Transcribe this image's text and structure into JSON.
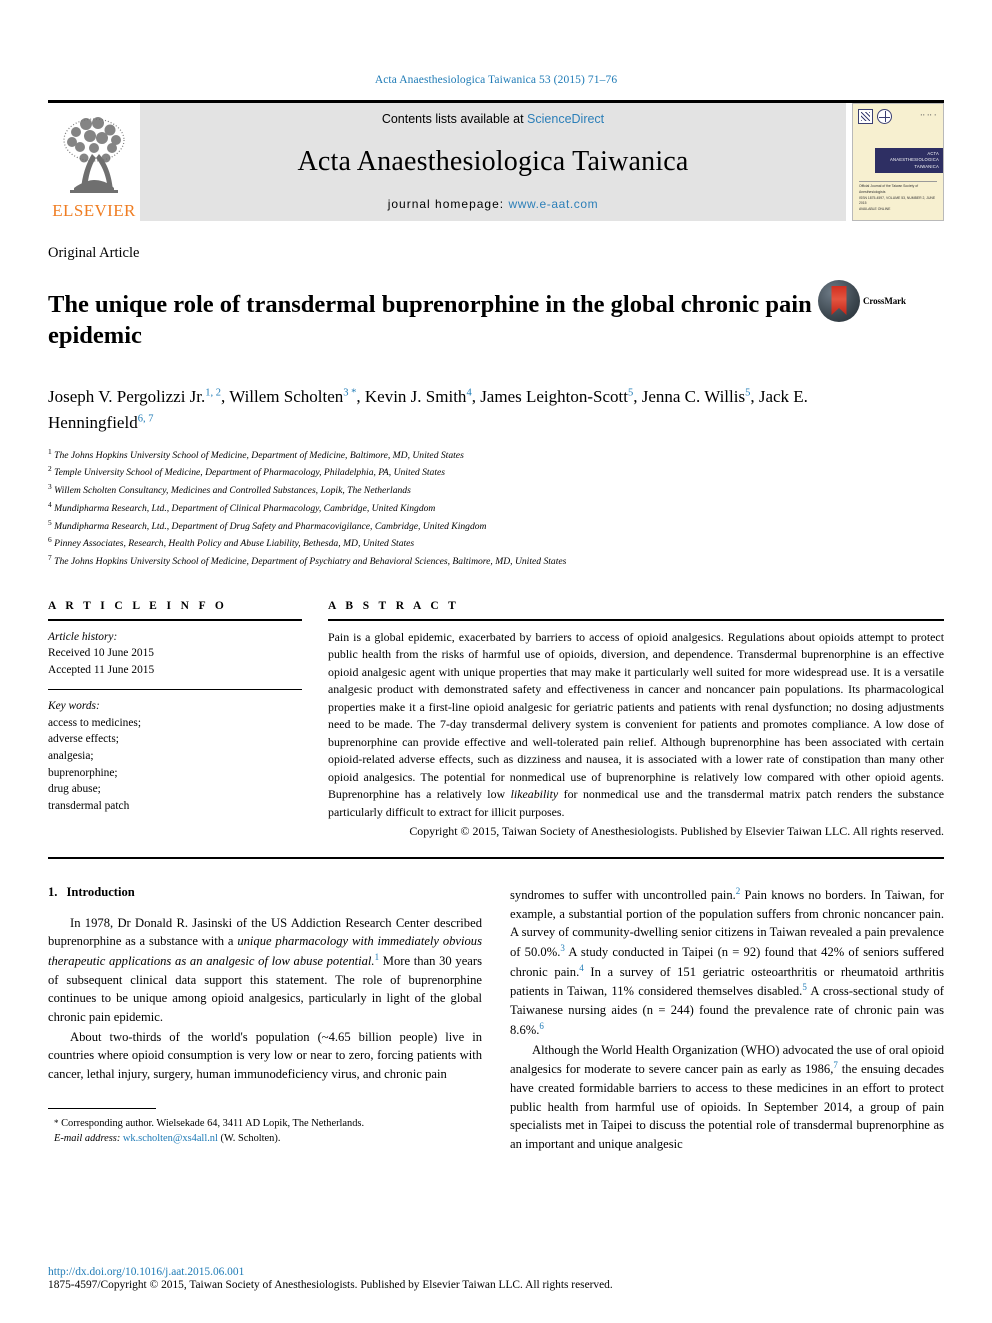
{
  "running_head": "Acta Anaesthesiologica Taiwanica 53 (2015) 71–76",
  "masthead": {
    "publisher_name": "ELSEVIER",
    "contents_prefix": "Contents lists available at ",
    "contents_link": "ScienceDirect",
    "journal_title": "Acta Anaesthesiologica Taiwanica",
    "homepage_label": "journal homepage: ",
    "homepage_url": "www.e-aat.com",
    "cover": {
      "band_line1": "ACTA ANAESTHESIOLOGICA",
      "band_line2": "TAIWANICA",
      "foot_line1": "Official Journal of the Taiwan Society of Anesthesiologists",
      "foot_line2": "ISSN 1875-4597, VOLUME 53, NUMBER 2, JUNE 2015",
      "foot_line3": "AVAILABLE ONLINE"
    }
  },
  "article": {
    "type": "Original Article",
    "title": "The unique role of transdermal buprenorphine in the global chronic pain epidemic",
    "crossmark_label": "CrossMark",
    "authors_line1": "Joseph V. Pergolizzi Jr.",
    "authors": [
      {
        "name": "Joseph V. Pergolizzi Jr.",
        "sup": "1, 2"
      },
      {
        "name": "Willem Scholten",
        "sup": "3 *"
      },
      {
        "name": "Kevin J. Smith",
        "sup": "4"
      },
      {
        "name": "James Leighton-Scott",
        "sup": "5"
      },
      {
        "name": "Jenna C. Willis",
        "sup": "5"
      },
      {
        "name": "Jack E. Henningfield",
        "sup": "6, 7"
      }
    ],
    "affiliations": [
      {
        "num": "1",
        "text": "The Johns Hopkins University School of Medicine, Department of Medicine, Baltimore, MD, United States"
      },
      {
        "num": "2",
        "text": "Temple University School of Medicine, Department of Pharmacology, Philadelphia, PA, United States"
      },
      {
        "num": "3",
        "text": "Willem Scholten Consultancy, Medicines and Controlled Substances, Lopik, The Netherlands"
      },
      {
        "num": "4",
        "text": "Mundipharma Research, Ltd., Department of Clinical Pharmacology, Cambridge, United Kingdom"
      },
      {
        "num": "5",
        "text": "Mundipharma Research, Ltd., Department of Drug Safety and Pharmacovigilance, Cambridge, United Kingdom"
      },
      {
        "num": "6",
        "text": "Pinney Associates, Research, Health Policy and Abuse Liability, Bethesda, MD, United States"
      },
      {
        "num": "7",
        "text": "The Johns Hopkins University School of Medicine, Department of Psychiatry and Behavioral Sciences, Baltimore, MD, United States"
      }
    ]
  },
  "article_info": {
    "heading": "A R T I C L E   I N F O",
    "history_label": "Article history:",
    "received": "Received 10 June 2015",
    "accepted": "Accepted 11 June 2015",
    "keywords_label": "Key words:",
    "keywords": [
      "access to medicines;",
      "adverse effects;",
      "analgesia;",
      "buprenorphine;",
      "drug abuse;",
      "transdermal patch"
    ]
  },
  "abstract": {
    "heading": "A B S T R A C T",
    "part1": "Pain is a global epidemic, exacerbated by barriers to access of opioid analgesics. Regulations about opioids attempt to protect public health from the risks of harmful use of opioids, diversion, and dependence. Transdermal buprenorphine is an effective opioid analgesic agent with unique properties that may make it particularly well suited for more widespread use. It is a versatile analgesic product with demonstrated safety and effectiveness in cancer and noncancer pain populations. Its pharmacological properties make it a first-line opioid analgesic for geriatric patients and patients with renal dysfunction; no dosing adjustments need to be made. The 7-day transdermal delivery system is convenient for patients and promotes compliance. A low dose of buprenorphine can provide effective and well-tolerated pain relief. Although buprenorphine has been associated with certain opioid-related adverse effects, such as dizziness and nausea, it is associated with a lower rate of constipation than many other opioid analgesics. The potential for nonmedical use of buprenorphine is relatively low compared with other opioid agents. Buprenorphine has a relatively low ",
    "italic_word": "likeability",
    "part2": " for nonmedical use and the transdermal matrix patch renders the substance particularly difficult to extract for illicit purposes.",
    "copyright": "Copyright © 2015, Taiwan Society of Anesthesiologists. Published by Elsevier Taiwan LLC. All rights reserved."
  },
  "introduction": {
    "section_number": "1.",
    "section_title": "Introduction",
    "p1_a": "In 1978, Dr Donald R. Jasinski of the US Addiction Research Center described buprenorphine as a substance with a ",
    "p1_italic": "unique pharmacology with immediately obvious therapeutic applications as an analgesic of low abuse potential.",
    "p1_cit": "1",
    "p1_b": " More than 30 years of subsequent clinical data support this statement. The role of buprenorphine continues to be unique among opioid analgesics, particularly in light of the global chronic pain epidemic.",
    "p2": "About two-thirds of the world's population (~4.65 billion people) live in countries where opioid consumption is very low or near to zero, forcing patients with cancer, lethal injury, surgery, human immunodeficiency virus, and chronic pain",
    "p2_cont_a": "syndromes to suffer with uncontrolled pain.",
    "p2_cit2": "2",
    "p2_cont_b": " Pain knows no borders. In Taiwan, for example, a substantial portion of the population suffers from chronic noncancer pain. A survey of community-dwelling senior citizens in Taiwan revealed a pain prevalence of 50.0%.",
    "p2_cit3": "3",
    "p2_cont_c": " A study conducted in Taipei (n = 92) found that 42% of seniors suffered chronic pain.",
    "p2_cit4": "4",
    "p2_cont_d": " In a survey of 151 geriatric osteoarthritis or rheumatoid arthritis patients in Taiwan, 11% considered themselves disabled.",
    "p2_cit5": "5",
    "p2_cont_e": " A cross-sectional study of Taiwanese nursing aides (n = 244) found the prevalence rate of chronic pain was 8.6%.",
    "p2_cit6": "6",
    "p3_a": "Although the World Health Organization (WHO) advocated the use of oral opioid analgesics for moderate to severe cancer pain as early as 1986,",
    "p3_cit7": "7",
    "p3_b": " the ensuing decades have created formidable barriers to access to these medicines in an effort to protect public health from harmful use of opioids. In September 2014, a group of pain specialists met in Taipei to discuss the potential role of transdermal buprenorphine as an important and unique analgesic"
  },
  "footnote": {
    "star": "*",
    "corresponding": " Corresponding author. Wielsekade 64, 3411 AD Lopik, The Netherlands.",
    "email_label": "E-mail address:",
    "email": "wk.scholten@xs4all.nl",
    "email_owner": " (W. Scholten)."
  },
  "page_footer": {
    "doi": "http://dx.doi.org/10.1016/j.aat.2015.06.001",
    "issn_line": "1875-4597/Copyright © 2015, Taiwan Society of Anesthesiologists. Published by Elsevier Taiwan LLC. All rights reserved."
  },
  "colors": {
    "link_blue": "#1f7bb6",
    "sciencedirect_blue": "#2c7fb8",
    "elsevier_orange": "#ef7d22",
    "banner_gray": "#e3e3e3"
  }
}
